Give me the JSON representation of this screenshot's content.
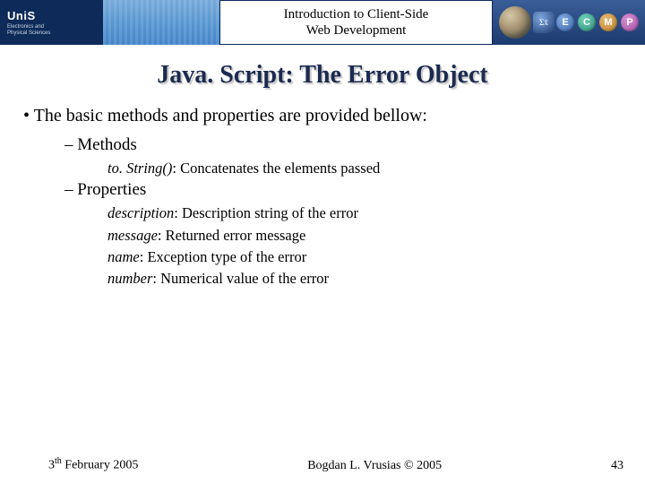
{
  "header": {
    "uni": "UniS",
    "dept_line1": "Electronics and",
    "dept_line2": "Physical Sciences",
    "course_title": "Introduction to Client-Side\nWeb Development",
    "badges": [
      "E",
      "C",
      "M",
      "P"
    ],
    "greek": "Σx̄"
  },
  "body": {
    "title": "Java. Script: The Error Object",
    "intro": "The basic methods and properties are provided bellow:",
    "methods_heading": "Methods",
    "methods": [
      {
        "name": "to. String()",
        "desc": "Concatenates the elements passed"
      }
    ],
    "properties_heading": "Properties",
    "properties": [
      {
        "name": "description",
        "desc": "Description string of the error"
      },
      {
        "name": "message",
        "desc": "Returned error message"
      },
      {
        "name": "name",
        "desc": "Exception type of the error"
      },
      {
        "name": "number",
        "desc": "Numerical value of the error"
      }
    ]
  },
  "footer": {
    "date_day": "3",
    "date_sup": "th",
    "date_rest": " February 2005",
    "center": "Bogdan L. Vrusias © 2005",
    "page": "43"
  }
}
